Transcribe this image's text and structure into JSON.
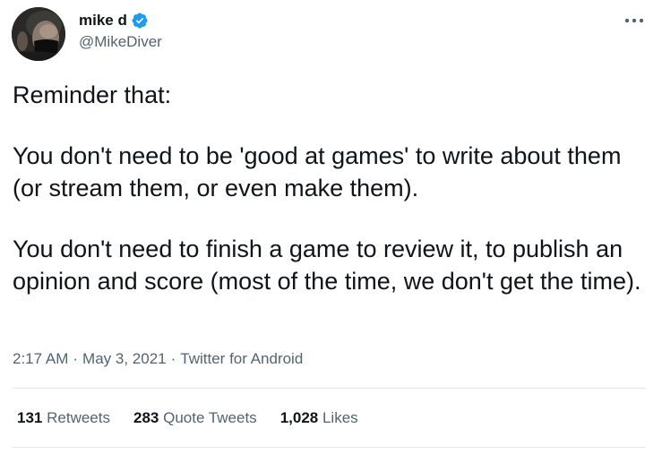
{
  "author": {
    "display_name": "mike d",
    "handle": "@MikeDiver",
    "verified_icon": "verified-badge-icon",
    "verified_color": "#1d9bf0",
    "avatar_icon": "profile-photo"
  },
  "tweet": {
    "text_lines": [
      "Reminder that:",
      "You don't need to be 'good at games' to write about them (or stream them, or even make them).",
      "You don't need to finish a game to review it, to publish an opinion and score (most of the time, we don't get the time)."
    ],
    "time": "2:17 AM",
    "date": "May 3, 2021",
    "source": "Twitter for Android",
    "separator": "·"
  },
  "stats": {
    "retweets": {
      "count": "131",
      "label": "Retweets"
    },
    "quote_tweets": {
      "count": "283",
      "label": "Quote Tweets"
    },
    "likes": {
      "count": "1,028",
      "label": "Likes"
    }
  },
  "menu": {
    "more_icon": "more-horizontal-icon"
  },
  "colors": {
    "text_primary": "#0f1419",
    "text_secondary": "#536471",
    "divider": "#e1e8ed"
  }
}
